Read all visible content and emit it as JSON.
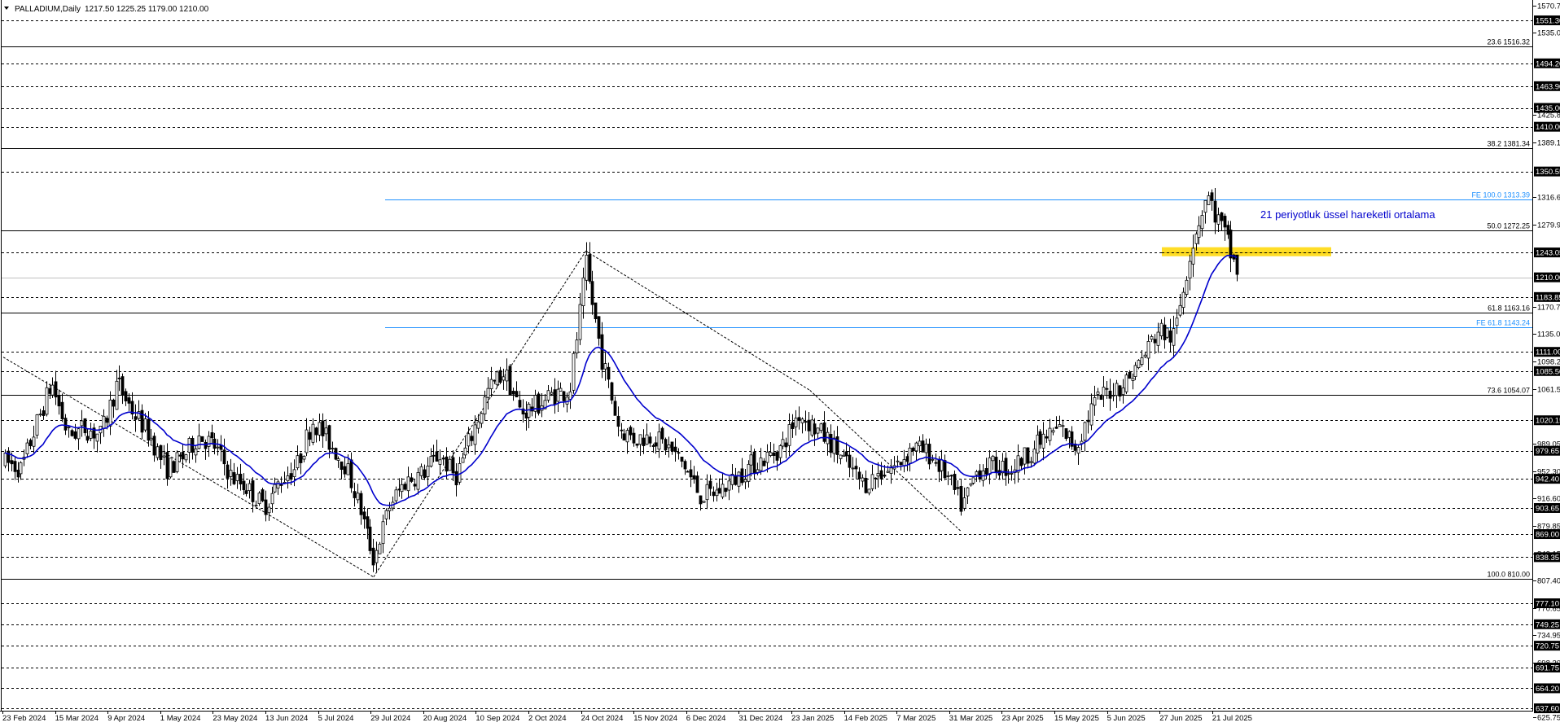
{
  "header": {
    "symbol": "PALLADIUM,Daily",
    "ohlc": "1217.50 1225.25 1179.00 1210.00"
  },
  "chart_data": {
    "type": "candlestick",
    "symbol": "PALLADIUM",
    "timeframe": "Daily",
    "ylim": [
      625.75,
      1570.75
    ],
    "grid": false,
    "price_axis_labels": [
      {
        "value": 1570.75,
        "text": "1570.75"
      },
      {
        "value": 1551.3,
        "text": "1551.30",
        "tag": true
      },
      {
        "value": 1535.05,
        "text": "1535.05"
      },
      {
        "value": 1494.2,
        "text": "1494.20",
        "tag": true
      },
      {
        "value": 1463.9,
        "text": "1463.90",
        "tag": true
      },
      {
        "value": 1435.0,
        "text": "1435.00",
        "tag": true
      },
      {
        "value": 1425.85,
        "text": "1425.85"
      },
      {
        "value": 1410.0,
        "text": "1410.00",
        "tag": true
      },
      {
        "value": 1389.1,
        "text": "1389.10"
      },
      {
        "value": 1350.55,
        "text": "1350.55",
        "tag": true
      },
      {
        "value": 1316.65,
        "text": "1316.65"
      },
      {
        "value": 1279.9,
        "text": "1279.90"
      },
      {
        "value": 1243.05,
        "text": "1243.05",
        "tag": true
      },
      {
        "value": 1210.0,
        "text": "1210.00",
        "tag": true
      },
      {
        "value": 1183.85,
        "text": "1183.85",
        "tag": true
      },
      {
        "value": 1170.7,
        "text": "1170.70"
      },
      {
        "value": 1135.0,
        "text": "1135.00"
      },
      {
        "value": 1111.0,
        "text": "1111.00",
        "tag": true
      },
      {
        "value": 1098.25,
        "text": "1098.25"
      },
      {
        "value": 1085.5,
        "text": "1085.50",
        "tag": true
      },
      {
        "value": 1061.5,
        "text": "1061.50"
      },
      {
        "value": 1020.15,
        "text": "1020.15",
        "tag": true
      },
      {
        "value": 989.05,
        "text": "989.05"
      },
      {
        "value": 979.65,
        "text": "979.65",
        "tag": true
      },
      {
        "value": 952.3,
        "text": "952.30"
      },
      {
        "value": 942.4,
        "text": "942.40",
        "tag": true
      },
      {
        "value": 916.6,
        "text": "916.60"
      },
      {
        "value": 903.65,
        "text": "903.65",
        "tag": true
      },
      {
        "value": 879.85,
        "text": "879.85"
      },
      {
        "value": 869.0,
        "text": "869.00",
        "tag": true
      },
      {
        "value": 843.15,
        "text": "843.15"
      },
      {
        "value": 838.35,
        "text": "838.35",
        "tag": true
      },
      {
        "value": 807.4,
        "text": "807.40"
      },
      {
        "value": 777.1,
        "text": "777.10",
        "tag": true
      },
      {
        "value": 770.65,
        "text": "770.65"
      },
      {
        "value": 749.25,
        "text": "749.25",
        "tag": true
      },
      {
        "value": 734.95,
        "text": "734.95"
      },
      {
        "value": 720.75,
        "text": "720.75",
        "tag": true
      },
      {
        "value": 698.2,
        "text": "698.20"
      },
      {
        "value": 691.75,
        "text": "691.75",
        "tag": true
      },
      {
        "value": 664.2,
        "text": "664.20",
        "tag": true
      },
      {
        "value": 637.6,
        "text": "637.60",
        "tag": true
      },
      {
        "value": 625.75,
        "text": "625.75"
      }
    ],
    "date_labels": [
      "23 Feb 2024",
      "15 Mar 2024",
      "9 Apr 2024",
      "1 May 2024",
      "23 May 2024",
      "13 Jun 2024",
      "5 Jul 2024",
      "29 Jul 2024",
      "20 Aug 2024",
      "10 Sep 2024",
      "2 Oct 2024",
      "24 Oct 2024",
      "15 Nov 2024",
      "6 Dec 2024",
      "31 Dec 2024",
      "23 Jan 2025",
      "14 Feb 2025",
      "7 Mar 2025",
      "31 Mar 2025",
      "23 Apr 2025",
      "15 May 2025",
      "5 Jun 2025",
      "27 Jun 2025",
      "21 Jul 2025"
    ],
    "horizontal_levels": [
      1551.3,
      1494.2,
      1463.9,
      1435.0,
      1410.0,
      1350.55,
      1243.05,
      1183.85,
      1111.0,
      1085.5,
      1020.15,
      979.65,
      942.4,
      903.65,
      869.0,
      838.35,
      777.1,
      749.25,
      720.75,
      691.75,
      664.2,
      637.6
    ],
    "fibonacci_levels": [
      {
        "price": 1516.32,
        "label": "23.6 1516.32"
      },
      {
        "price": 1381.34,
        "label": "38.2 1381.34"
      },
      {
        "price": 1272.25,
        "label": "50.0 1272.25"
      },
      {
        "price": 1163.16,
        "label": "61.8 1163.16"
      },
      {
        "price": 1054.07,
        "label": "73.6 1054.07"
      },
      {
        "price": 810.0,
        "label": "100.0 810.00"
      }
    ],
    "fe_levels": [
      {
        "price": 1313.39,
        "label": "FE 100.0 1313.39"
      },
      {
        "price": 1143.24,
        "label": "FE 61.8 1143.24"
      }
    ],
    "last_price": 1210.0,
    "zone": {
      "from": 1238,
      "to": 1250,
      "color": "#ffd700"
    },
    "annotation": "21 periyotluk üssel hareketli ortalama",
    "ema_period": 21,
    "series": [
      {
        "name": "21 periyotluk üssel hareketli ortalama",
        "color": "#0000cd"
      }
    ],
    "waves": [
      {
        "date": "2024-03-14",
        "price": 1000
      },
      {
        "date": "2024-07-30",
        "price": 812
      },
      {
        "date": "2024-10-29",
        "price": 1245
      },
      {
        "date": "2025-02-02",
        "price": 1060
      },
      {
        "date": "2025-04-08",
        "price": 872
      }
    ],
    "closes": [
      {
        "date": "2024-02-23",
        "close": 965
      },
      {
        "date": "2024-03-01",
        "close": 955
      },
      {
        "date": "2024-03-08",
        "close": 1020
      },
      {
        "date": "2024-03-14",
        "close": 1070
      },
      {
        "date": "2024-03-21",
        "close": 1000
      },
      {
        "date": "2024-03-28",
        "close": 1010
      },
      {
        "date": "2024-04-04",
        "close": 1000
      },
      {
        "date": "2024-04-11",
        "close": 1070
      },
      {
        "date": "2024-04-18",
        "close": 1030
      },
      {
        "date": "2024-04-25",
        "close": 1000
      },
      {
        "date": "2024-05-02",
        "close": 955
      },
      {
        "date": "2024-05-09",
        "close": 970
      },
      {
        "date": "2024-05-16",
        "close": 1000
      },
      {
        "date": "2024-05-23",
        "close": 985
      },
      {
        "date": "2024-05-30",
        "close": 945
      },
      {
        "date": "2024-06-06",
        "close": 930
      },
      {
        "date": "2024-06-13",
        "close": 905
      },
      {
        "date": "2024-06-20",
        "close": 940
      },
      {
        "date": "2024-06-27",
        "close": 960
      },
      {
        "date": "2024-07-04",
        "close": 1020
      },
      {
        "date": "2024-07-11",
        "close": 990
      },
      {
        "date": "2024-07-18",
        "close": 960
      },
      {
        "date": "2024-07-24",
        "close": 905
      },
      {
        "date": "2024-07-30",
        "close": 835
      },
      {
        "date": "2024-08-06",
        "close": 910
      },
      {
        "date": "2024-08-13",
        "close": 940
      },
      {
        "date": "2024-08-20",
        "close": 950
      },
      {
        "date": "2024-08-27",
        "close": 975
      },
      {
        "date": "2024-09-03",
        "close": 945
      },
      {
        "date": "2024-09-10",
        "close": 1000
      },
      {
        "date": "2024-09-17",
        "close": 1060
      },
      {
        "date": "2024-09-24",
        "close": 1085
      },
      {
        "date": "2024-10-01",
        "close": 1030
      },
      {
        "date": "2024-10-08",
        "close": 1040
      },
      {
        "date": "2024-10-15",
        "close": 1055
      },
      {
        "date": "2024-10-22",
        "close": 1060
      },
      {
        "date": "2024-10-29",
        "close": 1225
      },
      {
        "date": "2024-11-05",
        "close": 1100
      },
      {
        "date": "2024-11-12",
        "close": 1010
      },
      {
        "date": "2024-11-19",
        "close": 995
      },
      {
        "date": "2024-11-26",
        "close": 1000
      },
      {
        "date": "2024-12-03",
        "close": 985
      },
      {
        "date": "2024-12-10",
        "close": 960
      },
      {
        "date": "2024-12-17",
        "close": 920
      },
      {
        "date": "2024-12-24",
        "close": 925
      },
      {
        "date": "2024-12-31",
        "close": 940
      },
      {
        "date": "2025-01-07",
        "close": 960
      },
      {
        "date": "2025-01-14",
        "close": 970
      },
      {
        "date": "2025-01-21",
        "close": 985
      },
      {
        "date": "2025-01-28",
        "close": 1030
      },
      {
        "date": "2025-02-04",
        "close": 1010
      },
      {
        "date": "2025-02-11",
        "close": 990
      },
      {
        "date": "2025-02-18",
        "close": 960
      },
      {
        "date": "2025-02-25",
        "close": 935
      },
      {
        "date": "2025-03-04",
        "close": 950
      },
      {
        "date": "2025-03-11",
        "close": 960
      },
      {
        "date": "2025-03-18",
        "close": 985
      },
      {
        "date": "2025-03-25",
        "close": 975
      },
      {
        "date": "2025-04-01",
        "close": 950
      },
      {
        "date": "2025-04-08",
        "close": 905
      },
      {
        "date": "2025-04-15",
        "close": 955
      },
      {
        "date": "2025-04-22",
        "close": 960
      },
      {
        "date": "2025-04-29",
        "close": 955
      },
      {
        "date": "2025-05-06",
        "close": 975
      },
      {
        "date": "2025-05-13",
        "close": 995
      },
      {
        "date": "2025-05-20",
        "close": 1010
      },
      {
        "date": "2025-05-27",
        "close": 985
      },
      {
        "date": "2025-06-03",
        "close": 1040
      },
      {
        "date": "2025-06-10",
        "close": 1060
      },
      {
        "date": "2025-06-17",
        "close": 1070
      },
      {
        "date": "2025-06-24",
        "close": 1100
      },
      {
        "date": "2025-07-01",
        "close": 1140
      },
      {
        "date": "2025-07-08",
        "close": 1130
      },
      {
        "date": "2025-07-15",
        "close": 1250
      },
      {
        "date": "2025-07-22",
        "close": 1320
      },
      {
        "date": "2025-07-29",
        "close": 1270
      },
      {
        "date": "2025-08-05",
        "close": 1210
      }
    ]
  }
}
